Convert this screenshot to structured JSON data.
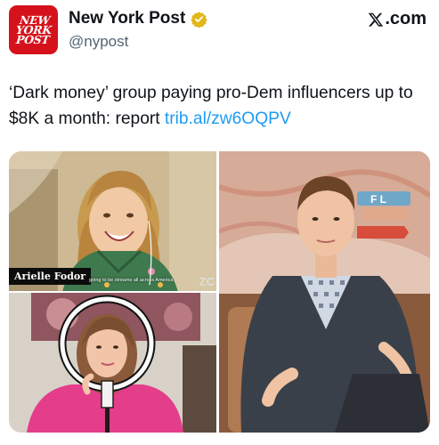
{
  "account": {
    "logo_lines": [
      "NEW",
      "YORK",
      "POST"
    ],
    "display_name": "New York Post",
    "handle": "@nypost",
    "verified_icon": "gold-verified-badge-icon",
    "site_label": ".com",
    "site_icon": "x-logo-icon"
  },
  "tweet": {
    "text": "‘Dark money’ group paying pro-Dem influencers up to $8K a month: report ",
    "link": "trib.al/zw6OQPV"
  },
  "media": {
    "panel1": {
      "nameplate": "Arielle Fodor",
      "caption": "going to be streams all across America",
      "corner_text": "ZC"
    },
    "panel3": {
      "sign_text": "F L"
    }
  },
  "colors": {
    "brand_red": "#d5121c",
    "link_blue": "#1d9bf0",
    "handle_gray": "#536471",
    "verified_gold": "#e2b719"
  }
}
